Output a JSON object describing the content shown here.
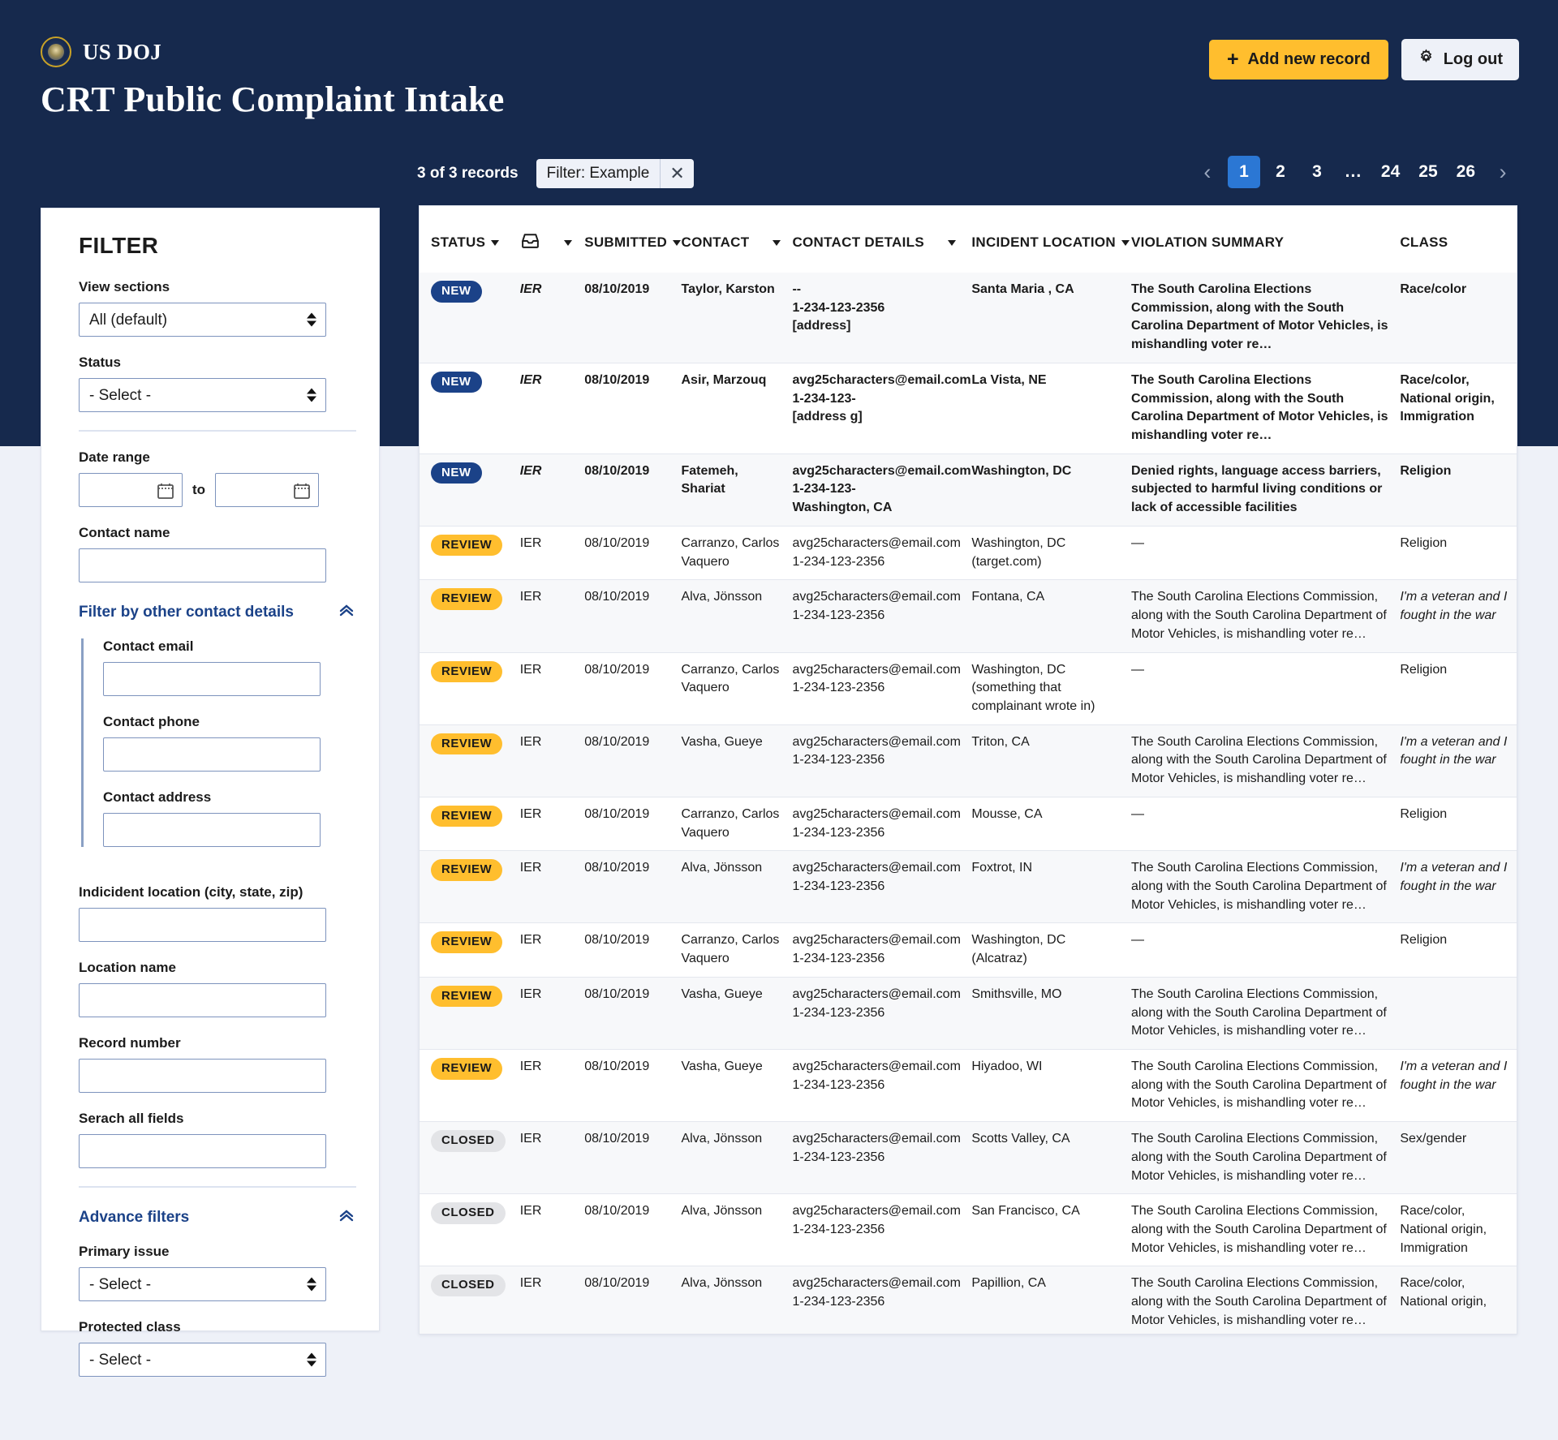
{
  "header": {
    "agency_name": "US DOJ",
    "seal_icon": "doj-seal-icon",
    "page_title": "CRT Public Complaint Intake",
    "add_record_label": "Add new record",
    "add_record_icon": "plus-icon",
    "logout_label": "Log out",
    "logout_icon": "gear-icon",
    "accent_yellow": "#ffbe2e",
    "navy": "#16294d",
    "page_bg": "#eef1f8"
  },
  "records_bar": {
    "count_text": "3 of 3 records",
    "filter_chip_label": "Filter: Example",
    "filter_chip_close_icon": "close-icon"
  },
  "pagination": {
    "prev_icon": "chevron-left-icon",
    "next_icon": "chevron-right-icon",
    "pages": [
      "1",
      "2",
      "3",
      "...",
      "24",
      "25",
      "26"
    ],
    "current": "1",
    "active_color": "#2b77d4"
  },
  "filter": {
    "title": "FILTER",
    "view_sections": {
      "label": "View sections",
      "value": "All (default)"
    },
    "status": {
      "label": "Status",
      "value": "- Select -"
    },
    "date_range": {
      "label": "Date range",
      "from_value": "",
      "to_word": "to",
      "to_value": "",
      "calendar_icon": "calendar-icon"
    },
    "contact_name": {
      "label": "Contact name",
      "value": ""
    },
    "other_contact_details": {
      "label": "Filter by other contact details",
      "toggle_icon": "chevron-up-icon",
      "contact_email": {
        "label": "Contact email",
        "value": ""
      },
      "contact_phone": {
        "label": "Contact phone",
        "value": ""
      },
      "contact_address": {
        "label": "Contact address",
        "value": ""
      }
    },
    "incident_location": {
      "label": "Indicident location (city, state, zip)",
      "value": ""
    },
    "location_name": {
      "label": "Location name",
      "value": ""
    },
    "record_number": {
      "label": "Record number",
      "value": ""
    },
    "search_all": {
      "label": "Serach all fields",
      "value": ""
    },
    "advance_filters": {
      "label": "Advance filters",
      "toggle_icon": "chevron-up-icon",
      "primary_issue": {
        "label": "Primary issue",
        "value": "- Select -"
      },
      "protected_class": {
        "label": "Protected class",
        "value": "- Select -"
      }
    }
  },
  "table": {
    "columns": [
      {
        "key": "status",
        "label": "STATUS",
        "sortable": true
      },
      {
        "key": "agency",
        "label": "",
        "icon": "inbox-icon",
        "sortable": true
      },
      {
        "key": "submitted",
        "label": "SUBMITTED",
        "sortable": true
      },
      {
        "key": "contact",
        "label": "CONTACT",
        "sortable": true
      },
      {
        "key": "contact_details",
        "label": "CONTACT DETAILS",
        "sortable": true
      },
      {
        "key": "incident_location",
        "label": "INCIDENT LOCATION",
        "sortable": true
      },
      {
        "key": "violation_summary",
        "label": "VIOLATION SUMMARY",
        "sortable": false
      },
      {
        "key": "class",
        "label": "CLASS",
        "sortable": false
      }
    ],
    "rows": [
      {
        "status": "NEW",
        "status_kind": "new",
        "agency": "IER",
        "agency_italic": true,
        "submitted": "08/10/2019",
        "contact": "Taylor, Karston",
        "email": "--",
        "phone": "1-234-123-2356",
        "address": "[address]",
        "location": "Santa Maria , CA",
        "location_sub": "",
        "summary": "The South Carolina Elections Commission, along with the South Carolina Department of Motor Vehicles, is mishandling voter re…",
        "class": "Race/color",
        "class_italic": false,
        "bold": true,
        "zebra": true
      },
      {
        "status": "NEW",
        "status_kind": "new",
        "agency": "IER",
        "agency_italic": true,
        "submitted": "08/10/2019",
        "contact": "Asir, Marzouq",
        "email": "avg25characters@email.com",
        "phone": "1-234-123-",
        "address": "[address g]",
        "location": "La Vista, NE",
        "location_sub": "",
        "summary": "The South Carolina Elections Commission, along with the South Carolina Department of Motor Vehicles, is mishandling voter re…",
        "class": "Race/color, National origin, Immigration",
        "class_italic": false,
        "bold": true,
        "zebra": false
      },
      {
        "status": "NEW",
        "status_kind": "new",
        "agency": "IER",
        "agency_italic": true,
        "submitted": "08/10/2019",
        "contact": "Fatemeh, Shariat",
        "email": "avg25characters@email.com",
        "phone": "1-234-123-",
        "address": "Washington, CA",
        "location": "Washington, DC",
        "location_sub": "",
        "summary": "Denied rights, language access barriers, subjected to harmful living conditions or lack of accessible facilities",
        "class": "Religion",
        "class_italic": false,
        "bold": true,
        "zebra": true
      },
      {
        "status": "REVIEW",
        "status_kind": "review",
        "agency": "IER",
        "agency_italic": false,
        "submitted": "08/10/2019",
        "contact": "Carranzo, Carlos Vaquero",
        "email": "avg25characters@email.com",
        "phone": "1-234-123-2356",
        "address": "",
        "location": "Washington, DC",
        "location_sub": "(target.com)",
        "summary": "—",
        "class": "Religion",
        "class_italic": false,
        "bold": false,
        "zebra": false
      },
      {
        "status": "REVIEW",
        "status_kind": "review",
        "agency": "IER",
        "agency_italic": false,
        "submitted": "08/10/2019",
        "contact": "Alva, Jönsson",
        "email": "avg25characters@email.com",
        "phone": "1-234-123-2356",
        "address": "",
        "location": "Fontana, CA",
        "location_sub": "",
        "summary": "The South Carolina Elections Commission, along with the South Carolina Department of Motor Vehicles, is mishandling voter re…",
        "class": "I'm a veteran and I fought in the war",
        "class_italic": true,
        "bold": false,
        "zebra": true
      },
      {
        "status": "REVIEW",
        "status_kind": "review",
        "agency": "IER",
        "agency_italic": false,
        "submitted": "08/10/2019",
        "contact": "Carranzo, Carlos Vaquero",
        "email": "avg25characters@email.com",
        "phone": "1-234-123-2356",
        "address": "",
        "location": "Washington, DC",
        "location_sub": "(something that complainant wrote in)",
        "summary": "—",
        "class": "Religion",
        "class_italic": false,
        "bold": false,
        "zebra": false
      },
      {
        "status": "REVIEW",
        "status_kind": "review",
        "agency": "IER",
        "agency_italic": false,
        "submitted": "08/10/2019",
        "contact": "Vasha, Gueye",
        "email": "avg25characters@email.com",
        "phone": "1-234-123-2356",
        "address": "",
        "location": "Triton, CA",
        "location_sub": "",
        "summary": "The South Carolina Elections Commission, along with the South Carolina Department of Motor Vehicles, is mishandling voter re…",
        "class": "I'm a veteran and I fought in the war",
        "class_italic": true,
        "bold": false,
        "zebra": true
      },
      {
        "status": "REVIEW",
        "status_kind": "review",
        "agency": "IER",
        "agency_italic": false,
        "submitted": "08/10/2019",
        "contact": "Carranzo, Carlos Vaquero",
        "email": "avg25characters@email.com",
        "phone": "1-234-123-2356",
        "address": "",
        "location": "Mousse, CA",
        "location_sub": "",
        "summary": "—",
        "class": "Religion",
        "class_italic": false,
        "bold": false,
        "zebra": false
      },
      {
        "status": "REVIEW",
        "status_kind": "review",
        "agency": "IER",
        "agency_italic": false,
        "submitted": "08/10/2019",
        "contact": "Alva, Jönsson",
        "email": "avg25characters@email.com",
        "phone": "1-234-123-2356",
        "address": "",
        "location": "Foxtrot, IN",
        "location_sub": "",
        "summary": "The South Carolina Elections Commission, along with the South Carolina Department of Motor Vehicles, is mishandling voter re…",
        "class": "I'm a veteran and I fought in the war",
        "class_italic": true,
        "bold": false,
        "zebra": true
      },
      {
        "status": "REVIEW",
        "status_kind": "review",
        "agency": "IER",
        "agency_italic": false,
        "submitted": "08/10/2019",
        "contact": "Carranzo, Carlos Vaquero",
        "email": "avg25characters@email.com",
        "phone": "1-234-123-2356",
        "address": "",
        "location": "Washington, DC",
        "location_sub": "(Alcatraz)",
        "summary": "—",
        "class": "Religion",
        "class_italic": false,
        "bold": false,
        "zebra": false
      },
      {
        "status": "REVIEW",
        "status_kind": "review",
        "agency": "IER",
        "agency_italic": false,
        "submitted": "08/10/2019",
        "contact": "Vasha, Gueye",
        "email": "avg25characters@email.com",
        "phone": "1-234-123-2356",
        "address": "",
        "location": "Smithsville, MO",
        "location_sub": "",
        "summary": "The South Carolina Elections Commission, along with the South Carolina Department of Motor Vehicles, is mishandling voter re…",
        "class": "",
        "class_italic": false,
        "bold": false,
        "zebra": true
      },
      {
        "status": "REVIEW",
        "status_kind": "review",
        "agency": "IER",
        "agency_italic": false,
        "submitted": "08/10/2019",
        "contact": "Vasha, Gueye",
        "email": "avg25characters@email.com",
        "phone": "1-234-123-2356",
        "address": "",
        "location": "Hiyadoo, WI",
        "location_sub": "",
        "summary": "The South Carolina Elections Commission, along with the South Carolina Department of Motor Vehicles, is mishandling voter re…",
        "class": "I'm a veteran and I fought in the war",
        "class_italic": true,
        "bold": false,
        "zebra": false
      },
      {
        "status": "CLOSED",
        "status_kind": "closed",
        "agency": "IER",
        "agency_italic": false,
        "submitted": "08/10/2019",
        "contact": "Alva, Jönsson",
        "email": "avg25characters@email.com",
        "phone": "1-234-123-2356",
        "address": "",
        "location": "Scotts Valley, CA",
        "location_sub": "",
        "summary": "The South Carolina Elections Commission, along with the South Carolina Department of Motor Vehicles, is mishandling voter re…",
        "class": "Sex/gender",
        "class_italic": false,
        "bold": false,
        "zebra": true
      },
      {
        "status": "CLOSED",
        "status_kind": "closed",
        "agency": "IER",
        "agency_italic": false,
        "submitted": "08/10/2019",
        "contact": "Alva, Jönsson",
        "email": "avg25characters@email.com",
        "phone": "1-234-123-2356",
        "address": "",
        "location": "San Francisco, CA",
        "location_sub": "",
        "summary": "The South Carolina Elections Commission, along with the South Carolina Department of Motor Vehicles, is mishandling voter re…",
        "class": "Race/color, National origin, Immigration",
        "class_italic": false,
        "bold": false,
        "zebra": false
      },
      {
        "status": "CLOSED",
        "status_kind": "closed",
        "agency": "IER",
        "agency_italic": false,
        "submitted": "08/10/2019",
        "contact": "Alva, Jönsson",
        "email": "avg25characters@email.com",
        "phone": "1-234-123-2356",
        "address": "",
        "location": "Papillion, CA",
        "location_sub": "",
        "summary": "The South Carolina Elections Commission, along with the South Carolina Department of Motor Vehicles, is mishandling voter re…",
        "class": "Race/color, National origin,",
        "class_italic": false,
        "bold": false,
        "zebra": true
      }
    ]
  }
}
